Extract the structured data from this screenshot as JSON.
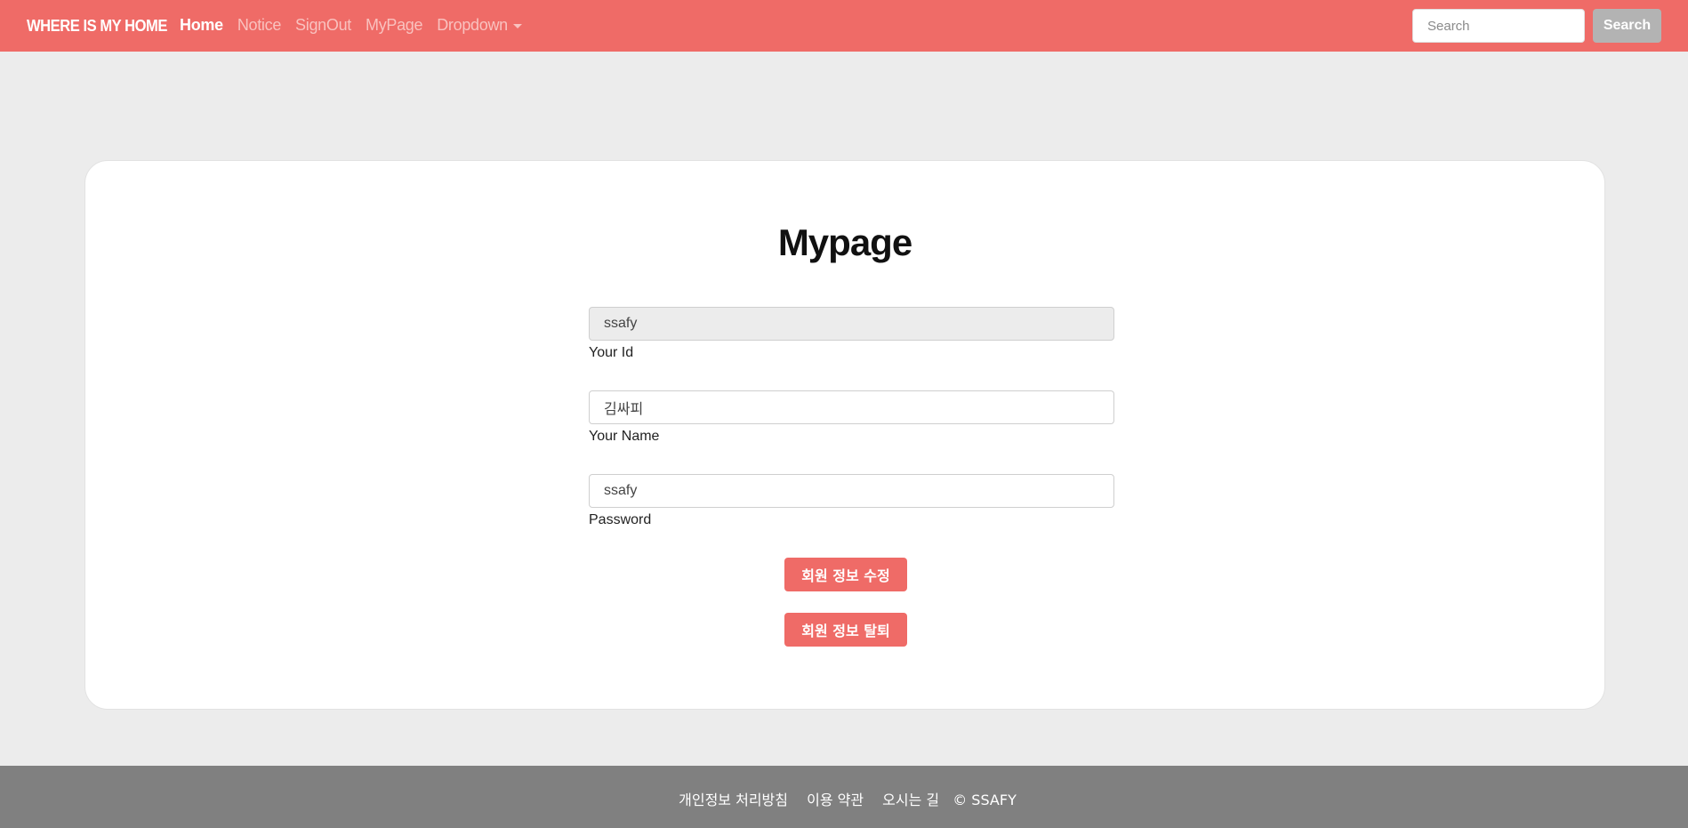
{
  "navbar": {
    "brand": "WHERE IS MY HOME",
    "links": [
      {
        "label": "Home"
      },
      {
        "label": "Notice"
      },
      {
        "label": "SignOut"
      },
      {
        "label": "MyPage"
      },
      {
        "label": "Dropdown"
      }
    ],
    "search_placeholder": "Search",
    "search_button": "Search"
  },
  "main": {
    "title": "Mypage",
    "fields": {
      "id": {
        "value": "ssafy",
        "label": "Your Id"
      },
      "name": {
        "value": "김싸피",
        "label": "Your Name"
      },
      "password": {
        "value": "ssafy",
        "label": "Password"
      }
    },
    "buttons": {
      "update": "회원 정보 수정",
      "delete": "회원 정보 탈퇴"
    }
  },
  "footer": {
    "links": [
      "개인정보 처리방침",
      "이용 약관",
      "오시는 길"
    ],
    "copyright": "© SSAFY"
  },
  "colors": {
    "accent": "#ef6b67",
    "background": "#ececec",
    "footer": "#808080",
    "search_button": "#b3b3b3"
  }
}
